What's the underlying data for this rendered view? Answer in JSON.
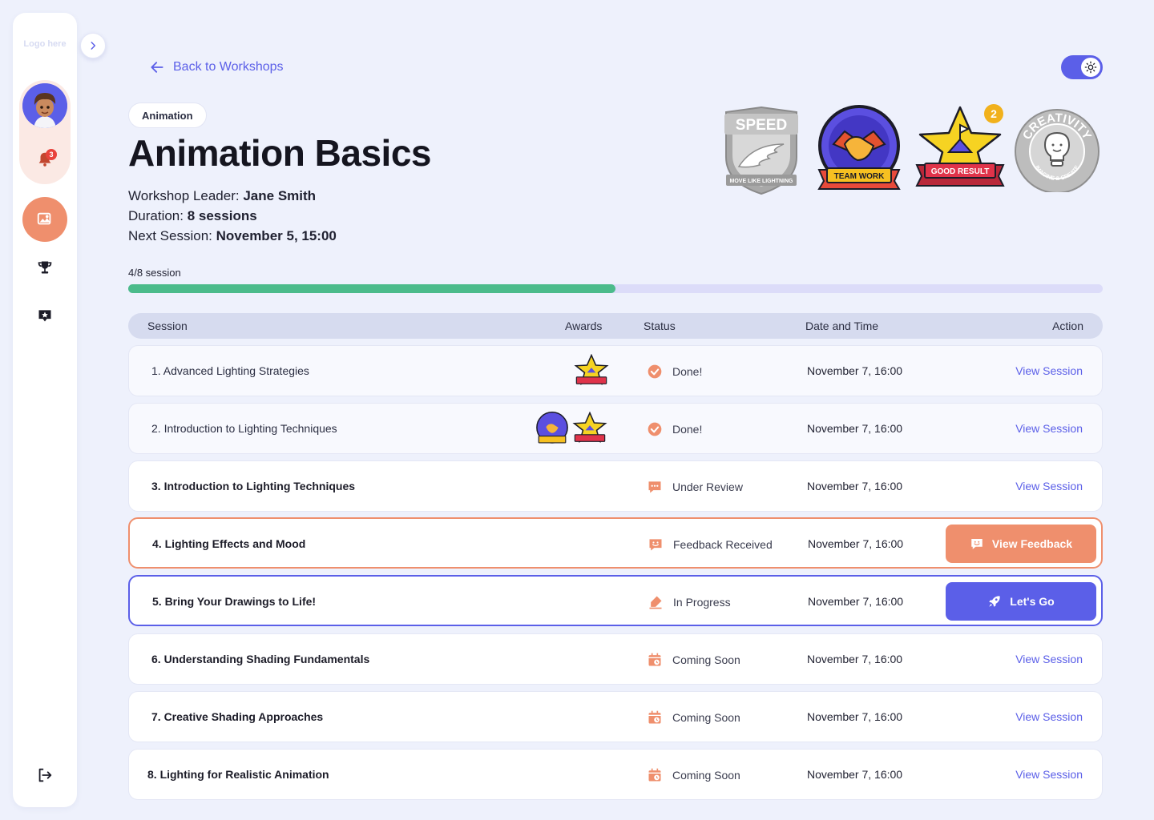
{
  "sidebar": {
    "logo": "Logo here",
    "notifications_count": "3",
    "items": [
      {
        "name": "gallery-icon",
        "active": true
      },
      {
        "name": "trophy-icon",
        "active": false
      },
      {
        "name": "star-badge-icon",
        "active": false
      },
      {
        "name": "logout-icon",
        "active": false
      }
    ]
  },
  "header": {
    "back_label": "Back to Workshops",
    "category": "Animation",
    "title": "Animation Basics",
    "leader_label": "Workshop Leader:",
    "leader_value": "Jane Smith",
    "duration_label": "Duration:",
    "duration_value": "8 sessions",
    "next_label": "Next Session:",
    "next_value": "November 5, 15:00"
  },
  "badges": [
    {
      "name": "speed-badge",
      "title": "SPEED",
      "subtitle": "MOVE LIKE LIGHTNING",
      "earned": false
    },
    {
      "name": "team-work-badge",
      "title": "TEAM WORK",
      "earned": true
    },
    {
      "name": "good-result-badge",
      "title": "GOOD RESULT",
      "earned": true,
      "count": "2"
    },
    {
      "name": "creativity-badge",
      "title": "CREATIVITY",
      "subtitle": "IMAGINE & CREATE",
      "earned": false
    }
  ],
  "progress": {
    "label": "4/8 session",
    "fraction": 0.5
  },
  "table": {
    "headers": {
      "session": "Session",
      "awards": "Awards",
      "status": "Status",
      "date": "Date and Time",
      "action": "Action"
    },
    "rows": [
      {
        "title": "1. Advanced Lighting Strategies",
        "awards": [
          "good-result"
        ],
        "status": "Done!",
        "status_icon": "check-badge-icon",
        "date": "November 7, 16:00",
        "action": "View Session"
      },
      {
        "title": "2. Introduction to Lighting Techniques",
        "awards": [
          "team-work",
          "good-result"
        ],
        "status": "Done!",
        "status_icon": "check-badge-icon",
        "date": "November 7, 16:00",
        "action": "View Session"
      },
      {
        "title": "3. Introduction to Lighting Techniques",
        "awards": [],
        "status": "Under Review",
        "status_icon": "chat-dots-icon",
        "date": "November 7, 16:00",
        "action": "View Session"
      },
      {
        "title": "4. Lighting Effects and Mood",
        "awards": [],
        "status": "Feedback Received",
        "status_icon": "smile-chat-icon",
        "date": "November 7, 16:00",
        "action": "View Feedback"
      },
      {
        "title": "5.  Bring Your Drawings to Life!",
        "awards": [],
        "status": "In Progress",
        "status_icon": "marker-icon",
        "date": "November 7, 16:00",
        "action": "Let's Go"
      },
      {
        "title": "6. Understanding Shading Fundamentals",
        "awards": [],
        "status": "Coming Soon",
        "status_icon": "calendar-clock-icon",
        "date": "November 7, 16:00",
        "action": "View Session"
      },
      {
        "title": "7. Creative Shading Approaches",
        "awards": [],
        "status": "Coming Soon",
        "status_icon": "calendar-clock-icon",
        "date": "November 7, 16:00",
        "action": "View Session"
      },
      {
        "title": "8. Lighting for Realistic Animation",
        "awards": [],
        "status": "Coming Soon",
        "status_icon": "calendar-clock-icon",
        "date": "November 7, 16:00",
        "action": "View Session"
      }
    ]
  },
  "colors": {
    "accent": "#5b5fe8",
    "orange": "#ef8f6d",
    "green": "#4bbb8b",
    "background": "#eef1fc"
  }
}
